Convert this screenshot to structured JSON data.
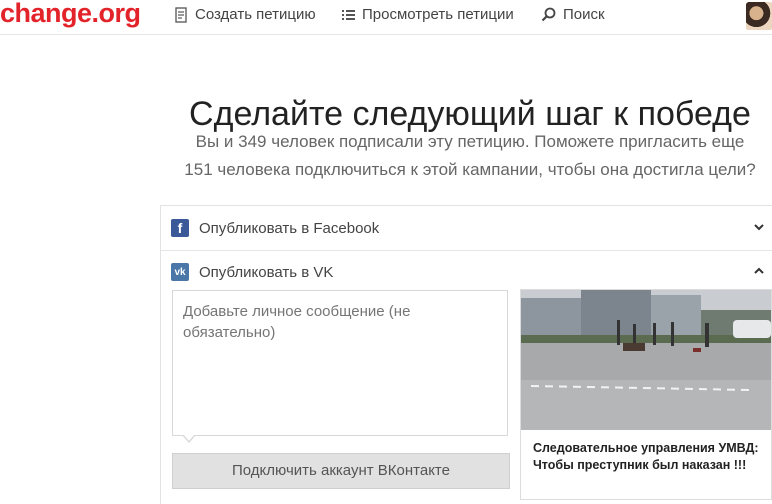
{
  "header": {
    "logo": "change.org",
    "nav": {
      "create": "Создать петицию",
      "browse": "Просмотреть петиции",
      "search": "Поиск"
    }
  },
  "main": {
    "title": "Сделайте следующий шаг к победе",
    "subtitle_line1": "Вы и 349 человек подписали эту петицию. Поможете пригласить еще",
    "subtitle_line2": "151 человека подключиться к этой кампании, чтобы она достигла цели?"
  },
  "share": {
    "facebook_label": "Опубликовать в Facebook",
    "vk_label": "Опубликовать в VK",
    "message_placeholder": "Добавьте личное сообщение (не обязательно)",
    "connect_button": "Подключить аккаунт ВКонтакте",
    "preview_caption": "Следовательное управления УМВД: Чтобы преступник был наказан !!!"
  },
  "colors": {
    "brand": "#e3232a",
    "facebook": "#3b5998",
    "vk": "#4a76a8"
  },
  "icons": [
    "document-icon",
    "list-icon",
    "search-icon",
    "facebook-icon",
    "vk-icon",
    "chevron-down-icon",
    "chevron-up-icon"
  ]
}
